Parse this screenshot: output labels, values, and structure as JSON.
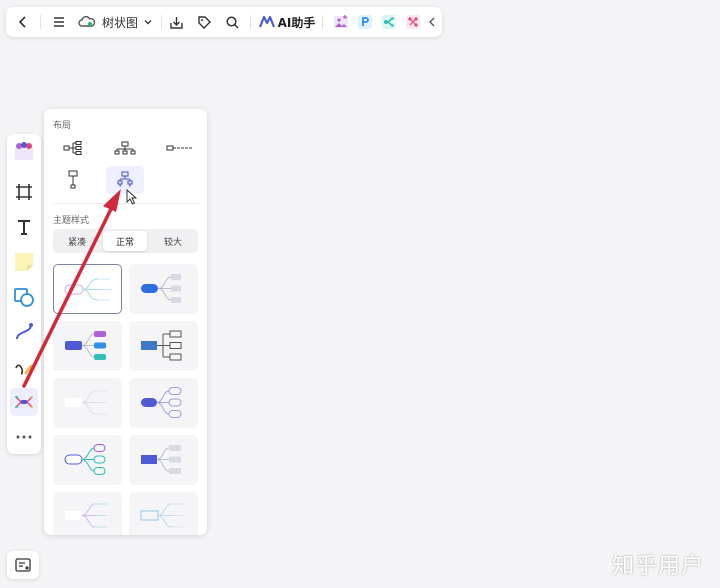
{
  "toolbar": {
    "view_name": "树状图",
    "ai_label": "AI助手"
  },
  "panel": {
    "layout_section": "布局",
    "theme_section": "主题样式",
    "density_options": [
      "紧凑",
      "正常",
      "较大"
    ],
    "density_selected": "正常"
  },
  "watermark": "知乎用户",
  "colors": {
    "accent": "#4f5bd5",
    "arrow": "#d3283a",
    "teal": "#2fbfb4",
    "purple": "#b05fd6"
  }
}
